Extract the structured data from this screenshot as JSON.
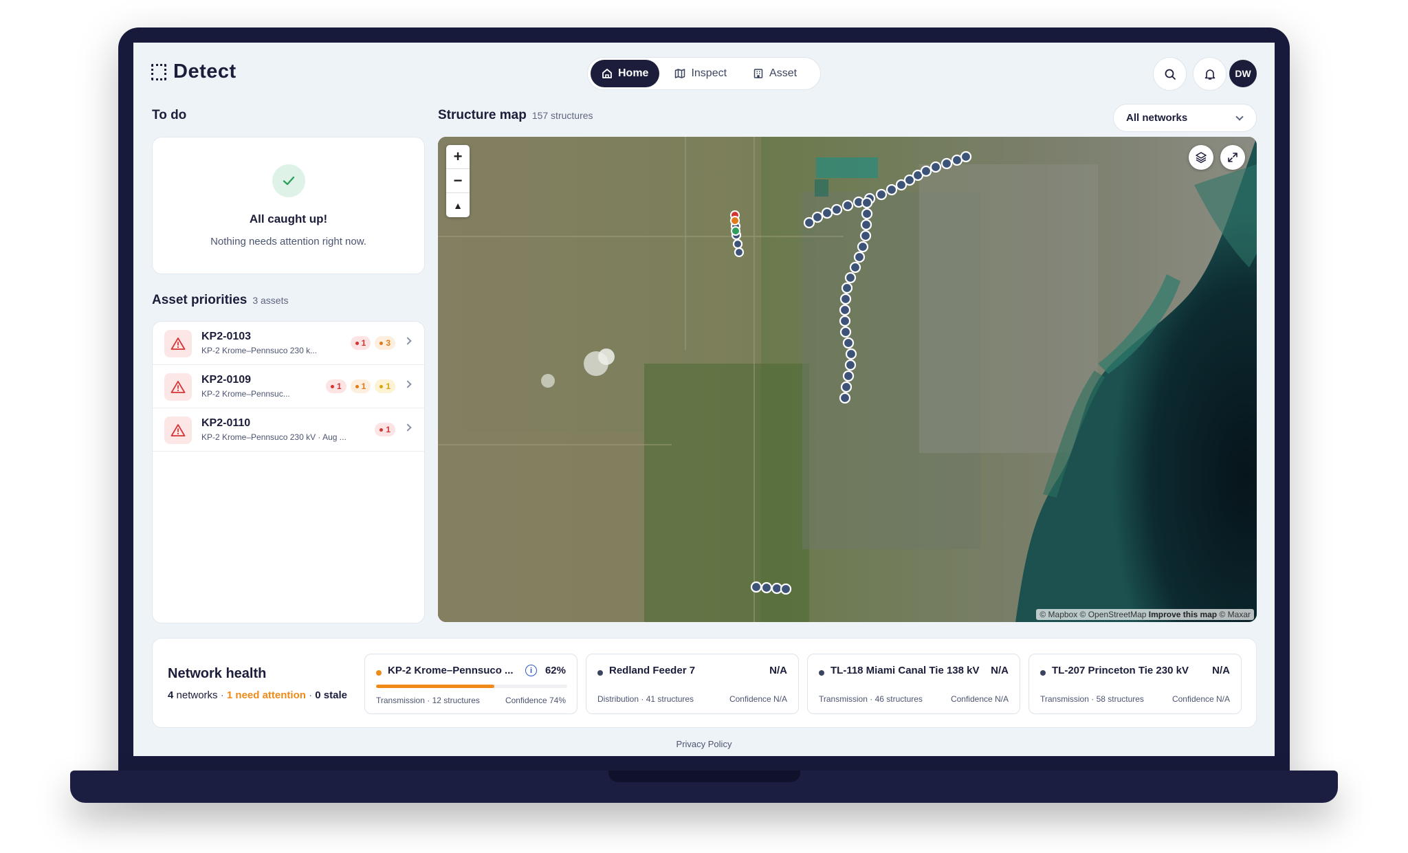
{
  "app": {
    "logo_text": "Detect"
  },
  "nav": {
    "items": [
      {
        "label": "Home",
        "icon": "home-icon",
        "active": true
      },
      {
        "label": "Inspect",
        "icon": "map-icon",
        "active": false
      },
      {
        "label": "Asset",
        "icon": "building-icon",
        "active": false
      }
    ]
  },
  "header": {
    "avatar_initials": "DW",
    "search_icon": "search-icon",
    "bell_icon": "bell-icon"
  },
  "todo": {
    "title": "To do",
    "card_title": "All caught up!",
    "card_subtitle": "Nothing needs attention right now."
  },
  "assets": {
    "title": "Asset priorities",
    "count": "3 assets",
    "items": [
      {
        "id": "KP2-0103",
        "desc": "KP-2 Krome–Pennsuco 230 k...",
        "badges": [
          {
            "color": "red",
            "value": "1"
          },
          {
            "color": "orange",
            "value": "3"
          }
        ]
      },
      {
        "id": "KP2-0109",
        "desc": "KP-2 Krome–Pennsuc...",
        "badges": [
          {
            "color": "red",
            "value": "1"
          },
          {
            "color": "orange",
            "value": "1"
          },
          {
            "color": "yellow",
            "value": "1"
          }
        ]
      },
      {
        "id": "KP2-0110",
        "desc": "KP-2 Krome–Pennsuco 230 kV · Aug ...",
        "badges": [
          {
            "color": "red",
            "value": "1"
          }
        ]
      }
    ]
  },
  "map": {
    "title": "Structure map",
    "count": "157 structures",
    "filter_value": "All networks",
    "zoom_in": "+",
    "zoom_out": "−",
    "compass": "▲",
    "attribution_left": "© Mapbox © OpenStreetMap",
    "attribution_link": "Improve this map",
    "attribution_right": "© Maxar"
  },
  "health": {
    "title": "Network health",
    "summary_count": "4",
    "summary_networks": "networks",
    "summary_sep1": "·",
    "summary_attention": "1 need attention",
    "summary_sep2": "·",
    "summary_stale": "0 stale",
    "networks": [
      {
        "name": "KP-2 Krome–Pennsuco ...",
        "value": "62%",
        "progress": 0.62,
        "dot_color": "#ef8a18",
        "type": "Transmission · 12 structures",
        "confidence": "Confidence 74%",
        "has_info": true
      },
      {
        "name": "Redland Feeder 7",
        "value": "N/A",
        "dot_color": "#3a4460",
        "type": "Distribution · 41 structures",
        "confidence": "Confidence N/A",
        "has_info": false
      },
      {
        "name": "TL-118 Miami Canal Tie 138 kV",
        "value": "N/A",
        "dot_color": "#3a4460",
        "type": "Transmission · 46 structures",
        "confidence": "Confidence N/A",
        "has_info": false
      },
      {
        "name": "TL-207 Princeton Tie 230 kV",
        "value": "N/A",
        "dot_color": "#3a4460",
        "type": "Transmission · 58 structures",
        "confidence": "Confidence N/A",
        "has_info": false
      }
    ]
  },
  "footer": {
    "privacy": "Privacy Policy"
  },
  "colors": {
    "brand_dark": "#1b1d3a",
    "attention": "#ef8a18",
    "danger": "#d43434",
    "success": "#2e9e5b"
  }
}
